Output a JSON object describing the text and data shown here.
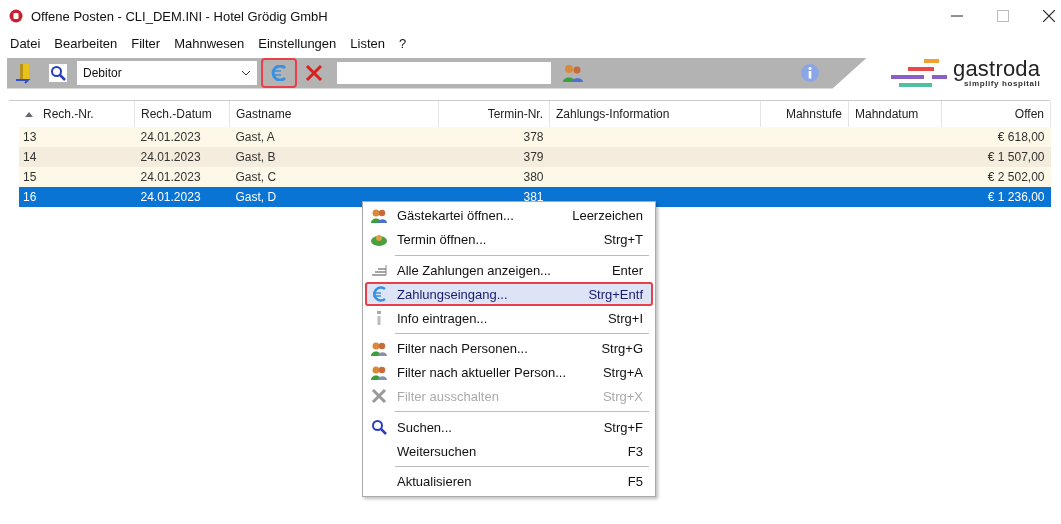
{
  "window": {
    "title": "Offene Posten - CLI_DEM.INI - Hotel Grödig GmbH"
  },
  "menu_bar": [
    "Datei",
    "Bearbeiten",
    "Filter",
    "Mahnwesen",
    "Einstellungen",
    "Listen",
    "?"
  ],
  "toolbar": {
    "account_type": "Debitor",
    "payment_button_marked": true,
    "logo": {
      "name": "gastroda",
      "tagline": "simplify hospitali"
    }
  },
  "table": {
    "columns": [
      {
        "label": "Rech.-Nr.",
        "sorted": true
      },
      {
        "label": "Rech.-Datum",
        "sorted": false
      },
      {
        "label": "Gastname",
        "sorted": false
      },
      {
        "label": "Termin-Nr.",
        "sorted": false
      },
      {
        "label": "Zahlungs-Information",
        "sorted": false
      },
      {
        "label": "Mahnstufe",
        "sorted": false
      },
      {
        "label": "Mahndatum",
        "sorted": false
      },
      {
        "label": "Offen",
        "sorted": false
      }
    ],
    "rows": [
      {
        "cells": [
          "13",
          "24.01.2023",
          "Gast, A",
          "378",
          "",
          "",
          "",
          "€ 618,00"
        ],
        "selected": false
      },
      {
        "cells": [
          "14",
          "24.01.2023",
          "Gast, B",
          "379",
          "",
          "",
          "",
          "€ 1 507,00"
        ],
        "selected": false
      },
      {
        "cells": [
          "15",
          "24.01.2023",
          "Gast, C",
          "380",
          "",
          "",
          "",
          "€ 2 502,00"
        ],
        "selected": false
      },
      {
        "cells": [
          "16",
          "24.01.2023",
          "Gast, D",
          "381",
          "",
          "",
          "",
          "€ 1 236,00"
        ],
        "selected": true
      }
    ]
  },
  "context_menu": [
    {
      "kind": "people",
      "label": "Gästekartei öffnen...",
      "shortcut": "Leerzeichen",
      "selected": false,
      "disabled": false,
      "marked": false
    },
    {
      "kind": "appointment",
      "label": "Termin öffnen...",
      "shortcut": "Strg+T",
      "selected": false,
      "disabled": false,
      "marked": false
    },
    {
      "kind": "separator"
    },
    {
      "kind": "list",
      "label": "Alle Zahlungen anzeigen...",
      "shortcut": "Enter",
      "selected": false,
      "disabled": false,
      "marked": false
    },
    {
      "kind": "euro",
      "label": "Zahlungseingang...",
      "shortcut": "Strg+Entf",
      "selected": true,
      "disabled": false,
      "marked": true
    },
    {
      "kind": "info",
      "label": "Info eintragen...",
      "shortcut": "Strg+I",
      "selected": false,
      "disabled": false,
      "marked": false
    },
    {
      "kind": "separator"
    },
    {
      "kind": "filter",
      "label": "Filter nach Personen...",
      "shortcut": "Strg+G",
      "selected": false,
      "disabled": false,
      "marked": false
    },
    {
      "kind": "filter",
      "label": "Filter nach aktueller Person...",
      "shortcut": "Strg+A",
      "selected": false,
      "disabled": false,
      "marked": false
    },
    {
      "kind": "cross",
      "label": "Filter ausschalten",
      "shortcut": "Strg+X",
      "selected": false,
      "disabled": true,
      "marked": false
    },
    {
      "kind": "separator"
    },
    {
      "kind": "search",
      "label": "Suchen...",
      "shortcut": "Strg+F",
      "selected": false,
      "disabled": false,
      "marked": false
    },
    {
      "kind": "plain",
      "label": "Weitersuchen",
      "shortcut": "F3",
      "selected": false,
      "disabled": false,
      "marked": false
    },
    {
      "kind": "separator"
    },
    {
      "kind": "plain",
      "label": "Aktualisieren",
      "shortcut": "F5",
      "selected": false,
      "disabled": false,
      "marked": false
    }
  ]
}
